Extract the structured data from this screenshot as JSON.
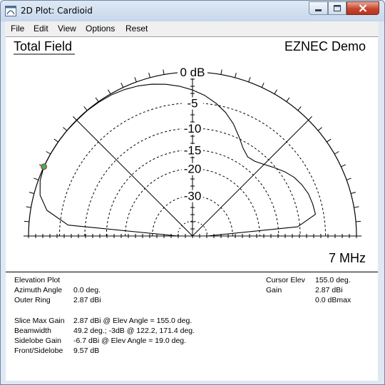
{
  "window": {
    "title": "2D Plot: Cardioid",
    "controls": {
      "minimize": "minimize-icon",
      "maximize": "maximize-icon",
      "close": "close-icon"
    }
  },
  "menu": [
    "File",
    "Edit",
    "View",
    "Options",
    "Reset"
  ],
  "plot": {
    "header_left": "Total Field",
    "header_right": "EZNEC Demo",
    "frequency": "7 MHz",
    "ring_labels": [
      "0 dB",
      "-5",
      "-10",
      "-15",
      "-20",
      "-30"
    ],
    "colors": {
      "trace": "#000000",
      "cursor": "#3bb84a"
    }
  },
  "chart_data": {
    "type": "line",
    "polar": true,
    "x_unit": "elevation angle (deg)",
    "y_unit": "gain relative to outer ring (dB)",
    "outer_ring_dbi": 2.87,
    "ring_values_db": [
      0,
      -5,
      -10,
      -15,
      -20,
      -30
    ],
    "x": [
      0,
      5,
      10,
      15,
      20,
      25,
      30,
      35,
      40,
      45,
      50,
      55,
      60,
      65,
      70,
      75,
      80,
      85,
      90,
      95,
      100,
      105,
      110,
      115,
      120,
      125,
      130,
      135,
      140,
      145,
      150,
      155,
      160,
      165,
      170,
      175,
      180
    ],
    "y": [
      -40,
      -10.5,
      -6.6,
      -6.7,
      -6.9,
      -7.4,
      -8.1,
      -9.1,
      -10.3,
      -11.5,
      -12.4,
      -12.6,
      -11.5,
      -9.6,
      -7.7,
      -6.0,
      -4.7,
      -3.7,
      -2.9,
      -2.2,
      -1.6,
      -1.1,
      -0.7,
      -0.4,
      -0.2,
      -0.1,
      -0.05,
      -0.05,
      0,
      0,
      0,
      0,
      -0.3,
      -1.0,
      -2.6,
      -6.6,
      -40
    ],
    "cursor": {
      "angle": 155.0
    }
  },
  "info": {
    "left": [
      {
        "label": "Elevation Plot",
        "value": ""
      },
      {
        "label": "Azimuth Angle",
        "value": "0.0 deg."
      },
      {
        "label": "Outer Ring",
        "value": "2.87 dBi"
      },
      {
        "label": "",
        "value": ""
      },
      {
        "label": "Slice Max Gain",
        "value": "2.87 dBi @ Elev Angle = 155.0 deg."
      },
      {
        "label": "Beamwidth",
        "value": "49.2 deg.; -3dB @ 122.2, 171.4 deg."
      },
      {
        "label": "Sidelobe Gain",
        "value": "-6.7 dBi @ Elev Angle = 19.0 deg."
      },
      {
        "label": "Front/Sidelobe",
        "value": "9.57 dB"
      }
    ],
    "right": [
      {
        "label": "Cursor Elev",
        "value": "155.0 deg."
      },
      {
        "label": "Gain",
        "value": "2.87 dBi"
      },
      {
        "label": "",
        "value": "0.0 dBmax"
      }
    ]
  }
}
